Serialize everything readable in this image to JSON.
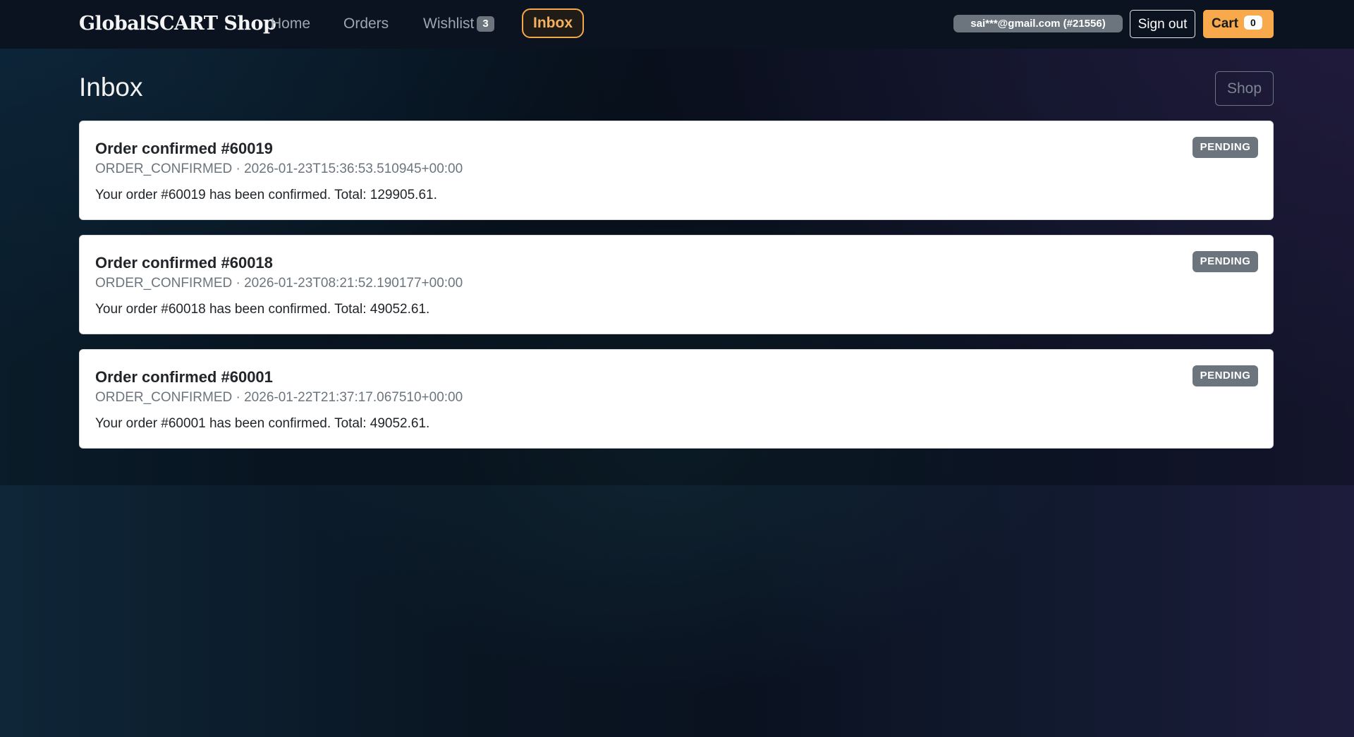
{
  "navbar": {
    "brand": "GlobalSCART Shop",
    "links": {
      "home": "Home",
      "orders": "Orders",
      "wishlist": "Wishlist",
      "inbox": "Inbox"
    },
    "wishlist_count": "3",
    "user": "sai***@gmail.com (#21556)",
    "signout_label": "Sign out",
    "cart_label": "Cart",
    "cart_count": "0",
    "active_link": "Inbox"
  },
  "page": {
    "title": "Inbox",
    "shop_button": "Shop"
  },
  "notifications": [
    {
      "title": "Order confirmed #60019",
      "type": "ORDER_CONFIRMED",
      "timestamp": "2026-01-23T15:36:53.510945+00:00",
      "meta": "ORDER_CONFIRMED · 2026-01-23T15:36:53.510945+00:00",
      "body": "Your order #60019 has been confirmed. Total: 129905.61.",
      "status": "PENDING"
    },
    {
      "title": "Order confirmed #60018",
      "type": "ORDER_CONFIRMED",
      "timestamp": "2026-01-23T08:21:52.190177+00:00",
      "meta": "ORDER_CONFIRMED · 2026-01-23T08:21:52.190177+00:00",
      "body": "Your order #60018 has been confirmed. Total: 49052.61.",
      "status": "PENDING"
    },
    {
      "title": "Order confirmed #60001",
      "type": "ORDER_CONFIRMED",
      "timestamp": "2026-01-22T21:37:17.067510+00:00",
      "meta": "ORDER_CONFIRMED · 2026-01-22T21:37:17.067510+00:00",
      "body": "Your order #60001 has been confirmed. Total: 49052.61.",
      "status": "PENDING"
    }
  ],
  "colors": {
    "accent": "#f7a94b",
    "navbar_bg": "#0b1320",
    "badge_gray": "#6c757d",
    "card_bg": "#ffffff"
  }
}
